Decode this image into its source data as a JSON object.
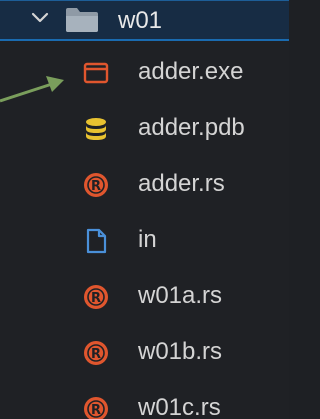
{
  "folder": {
    "name": "w01",
    "expanded": true,
    "icon": "folder-icon",
    "chevron_icon": "chevron-down-icon"
  },
  "files": [
    {
      "name": "adder.exe",
      "icon": "window-exe-icon",
      "color": "#e0562e"
    },
    {
      "name": "adder.pdb",
      "icon": "database-icon",
      "color": "#e8c230"
    },
    {
      "name": "adder.rs",
      "icon": "rust-icon",
      "color": "#e0562e"
    },
    {
      "name": "in",
      "icon": "file-icon",
      "color": "#4a90d9"
    },
    {
      "name": "w01a.rs",
      "icon": "rust-icon",
      "color": "#e0562e"
    },
    {
      "name": "w01b.rs",
      "icon": "rust-icon",
      "color": "#e0562e"
    },
    {
      "name": "w01c.rs",
      "icon": "rust-icon",
      "color": "#e0562e"
    }
  ],
  "colors": {
    "selection_bg": "#172c44",
    "selection_border": "#1a6bb0",
    "annotation_arrow": "#7a9e5c"
  }
}
